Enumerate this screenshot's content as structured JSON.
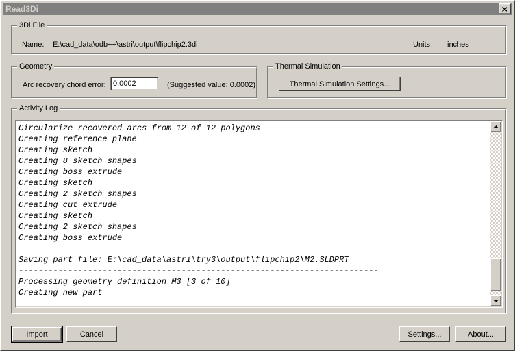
{
  "window": {
    "title": "Read3Di",
    "close_label": "Close",
    "bg_color": "#d4d0c8",
    "titlebar_color": "#808080",
    "title_text_color": "#d4d0c8"
  },
  "file_group": {
    "legend": "3Di File",
    "name_label": "Name:",
    "name_value": "E:\\cad_data\\odb++\\astri\\output\\flipchip2.3di",
    "units_label": "Units:",
    "units_value": "inches"
  },
  "geometry_group": {
    "legend": "Geometry",
    "chord_error_label": "Arc recovery chord error:",
    "chord_error_value": "0.0002",
    "chord_error_placeholder": "0.0002",
    "suggested_text": "(Suggested value: 0.0002)"
  },
  "thermal_group": {
    "legend": "Thermal Simulation",
    "settings_button": "Thermal Simulation Settings..."
  },
  "activity_log": {
    "legend": "Activity Log",
    "lines": [
      "Circularize recovered arcs from 12 of 12 polygons",
      "Creating reference plane",
      "Creating sketch",
      "Creating 8 sketch shapes",
      "Creating boss extrude",
      "Creating sketch",
      "Creating 2 sketch shapes",
      "Creating cut extrude",
      "Creating sketch",
      "Creating 2 sketch shapes",
      "Creating boss extrude",
      "",
      "Saving part file: E:\\cad_data\\astri\\try3\\output\\flipchip2\\M2.SLDPRT",
      "-------------------------------------------------------------------------",
      "Processing geometry definition M3 [3 of 10]",
      "Creating new part"
    ],
    "text": "Circularize recovered arcs from 12 of 12 polygons\nCreating reference plane\nCreating sketch\nCreating 8 sketch shapes\nCreating boss extrude\nCreating sketch\nCreating 2 sketch shapes\nCreating cut extrude\nCreating sketch\nCreating 2 sketch shapes\nCreating boss extrude\n\nSaving part file: E:\\cad_data\\astri\\try3\\output\\flipchip2\\M2.SLDPRT\n-------------------------------------------------------------------------\nProcessing geometry definition M3 [3 of 10]\nCreating new part",
    "scrollbar": {
      "up_arrow": "scroll-up",
      "down_arrow": "scroll-down",
      "thumb_position": "near-bottom"
    }
  },
  "footer": {
    "import_button": "Import",
    "cancel_button": "Cancel",
    "settings_button": "Settings...",
    "about_button": "About..."
  }
}
